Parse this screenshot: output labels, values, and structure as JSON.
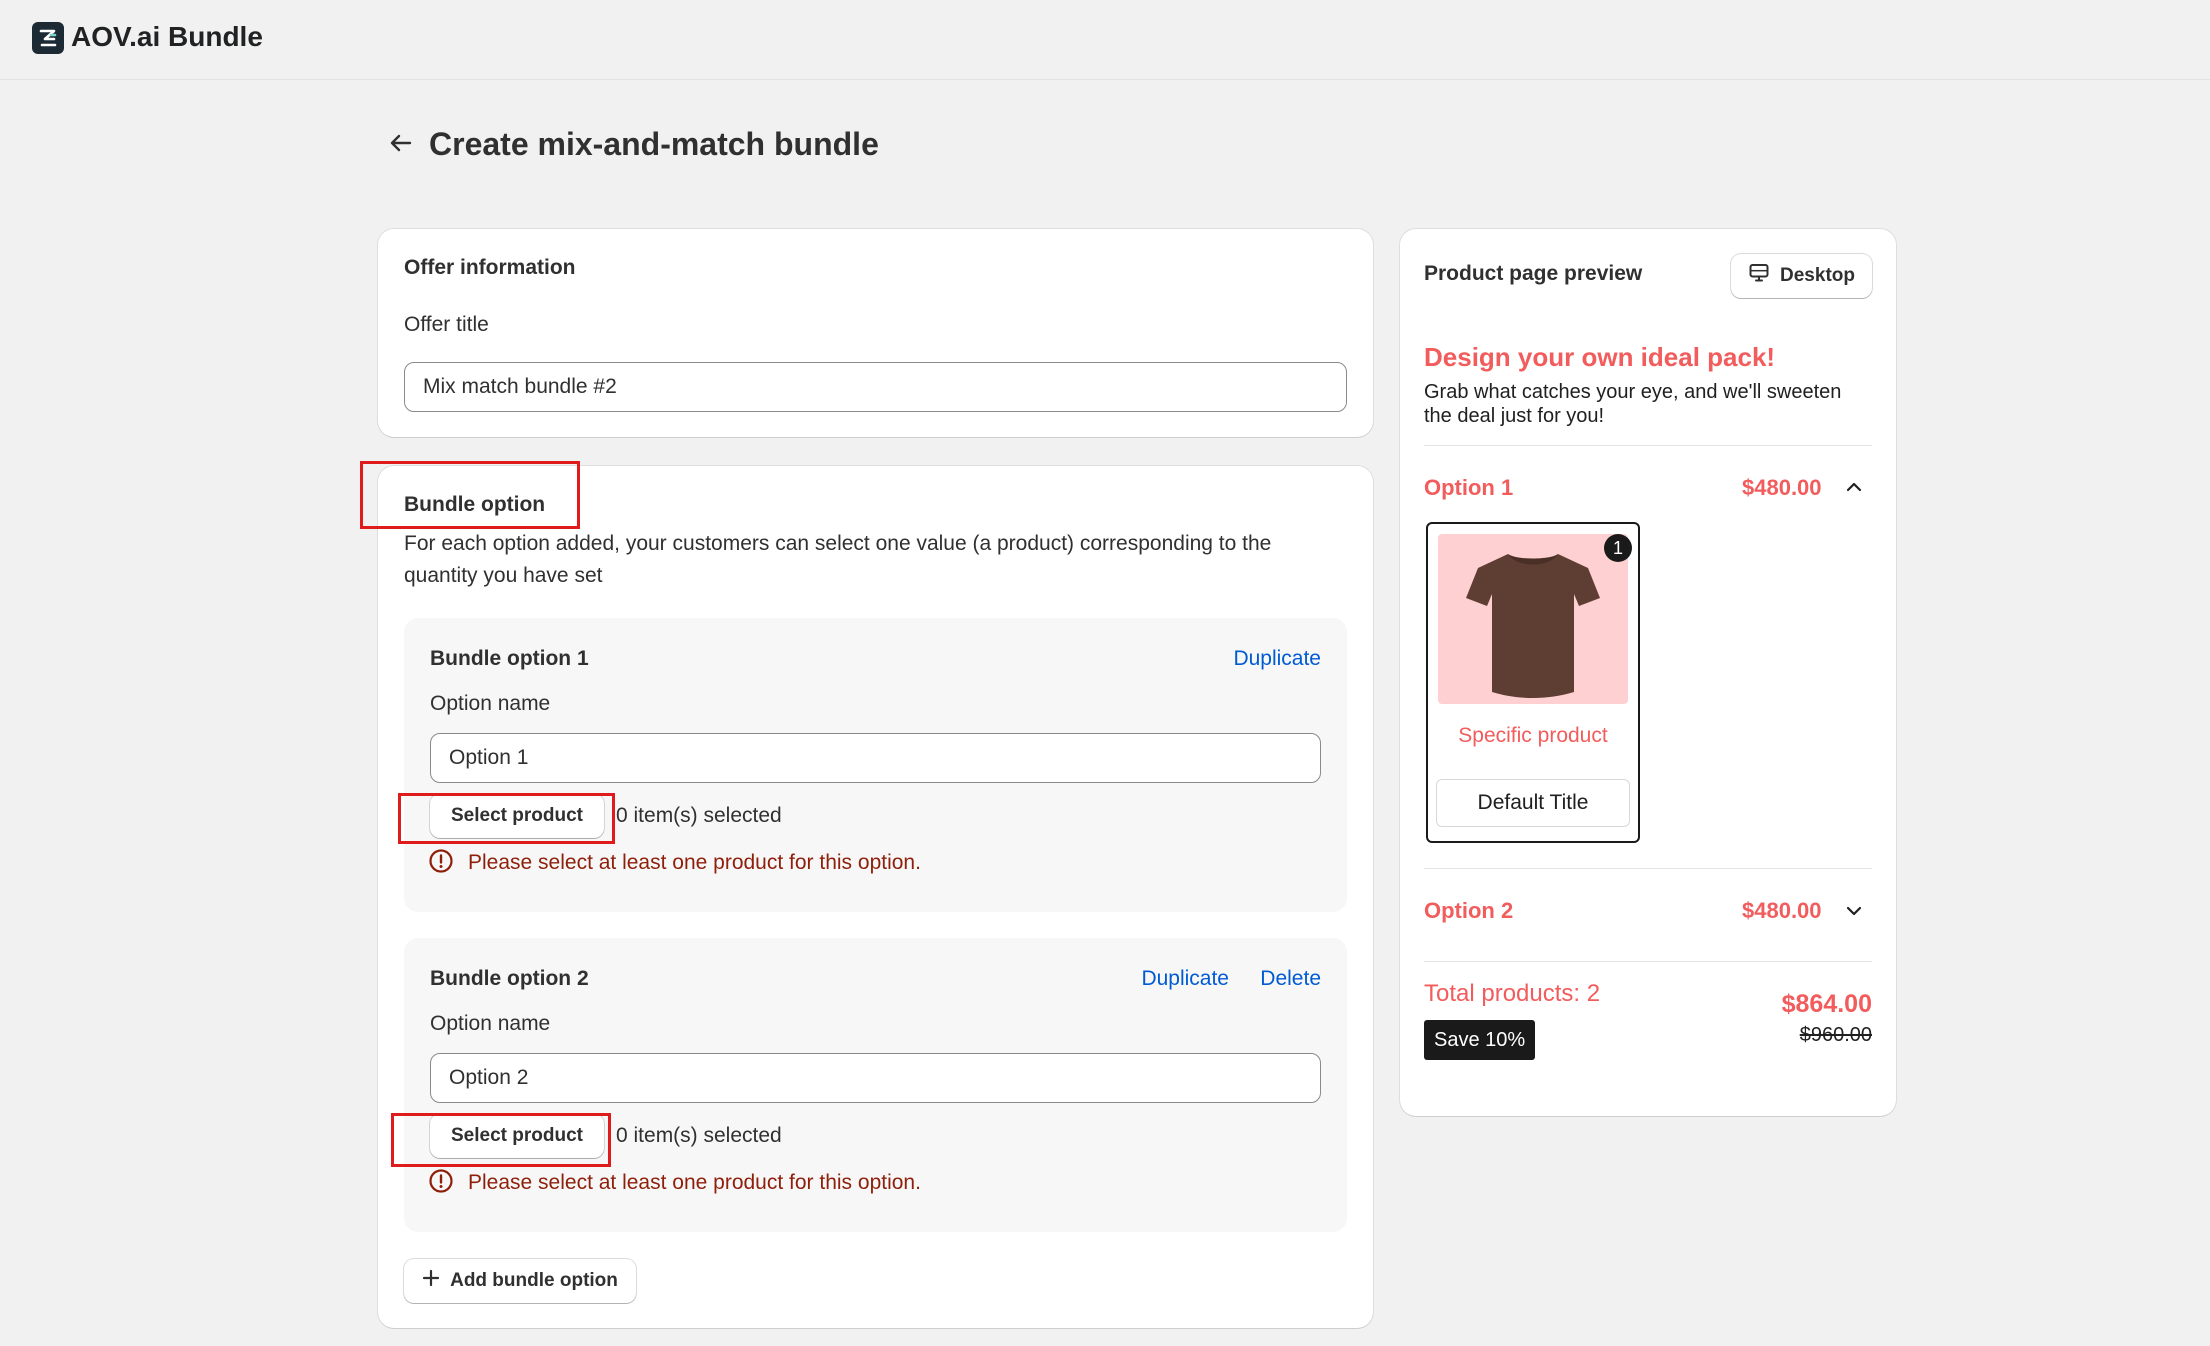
{
  "app": {
    "name": "AOV.ai Bundle"
  },
  "page": {
    "title": "Create mix-and-match bundle"
  },
  "offer": {
    "section_title": "Offer information",
    "title_label": "Offer title",
    "title_value": "Mix match bundle #2"
  },
  "bundle": {
    "section_title": "Bundle option",
    "description": "For each option added, your customers can select one value (a product) corresponding to the quantity you have set",
    "options": [
      {
        "heading": "Bundle option 1",
        "duplicate_label": "Duplicate",
        "name_label": "Option name",
        "name_value": "Option 1",
        "select_label": "Select product",
        "selected_count": "0 item(s) selected",
        "error": "Please select at least one product for this option."
      },
      {
        "heading": "Bundle option 2",
        "duplicate_label": "Duplicate",
        "delete_label": "Delete",
        "name_label": "Option name",
        "name_value": "Option 2",
        "select_label": "Select product",
        "selected_count": "0 item(s) selected",
        "error": "Please select at least one product for this option."
      }
    ],
    "add_label": "Add bundle option"
  },
  "preview": {
    "title": "Product page preview",
    "device_label": "Desktop",
    "headline": "Design your own ideal pack!",
    "subtext": "Grab what catches your eye, and we'll sweeten the deal just for you!",
    "option1": {
      "label": "Option 1",
      "price": "$480.00"
    },
    "product": {
      "quantity": "1",
      "name": "Specific product",
      "variant": "Default Title"
    },
    "option2": {
      "label": "Option 2",
      "price": "$480.00"
    },
    "total_label": "Total products: 2",
    "save_label": "Save 10%",
    "total_price": "$864.00",
    "original_price": "$960.00"
  },
  "colors": {
    "accent_pink": "#f25c5c",
    "link_blue": "#005bd3",
    "error_red": "#8e1f0b",
    "highlight_red": "#e01b1b",
    "shirt_brown": "#5e3d33",
    "product_bg": "#ffd0d2"
  }
}
